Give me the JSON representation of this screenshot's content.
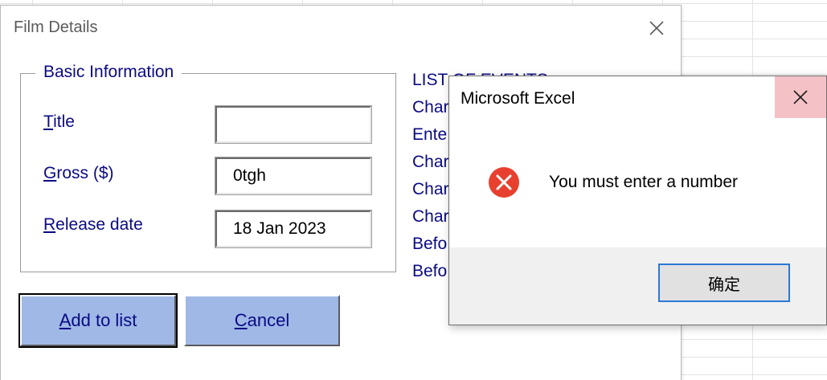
{
  "userform": {
    "title": "Film Details",
    "close_icon": "close-icon",
    "frame": {
      "legend": "Basic Information",
      "fields": [
        {
          "label_acc": "T",
          "label_rest": "itle",
          "value": ""
        },
        {
          "label_acc": "G",
          "label_rest": "ross ($)",
          "value": "0tgh"
        },
        {
          "label_acc": "R",
          "label_rest": "elease date",
          "value": "18 Jan 2023"
        }
      ]
    },
    "events": [
      "LIST OF EVENTS",
      "Char",
      "Ente",
      "Char",
      "Char",
      "Char",
      "Befo",
      "Befo"
    ],
    "buttons": {
      "add": {
        "acc": "A",
        "rest": "dd to list"
      },
      "cancel": {
        "acc": "C",
        "rest": "ancel"
      }
    }
  },
  "msgbox": {
    "title": "Microsoft Excel",
    "icon": "error-icon",
    "message": "You must enter a number",
    "ok_label": "确定",
    "colors": {
      "error_red": "#e8402f",
      "close_hover": "#f4c2c6",
      "focus_blue": "#2b78d6"
    }
  },
  "theme": {
    "label_color": "#0a0a84",
    "button_fill": "#9fb8e6"
  }
}
